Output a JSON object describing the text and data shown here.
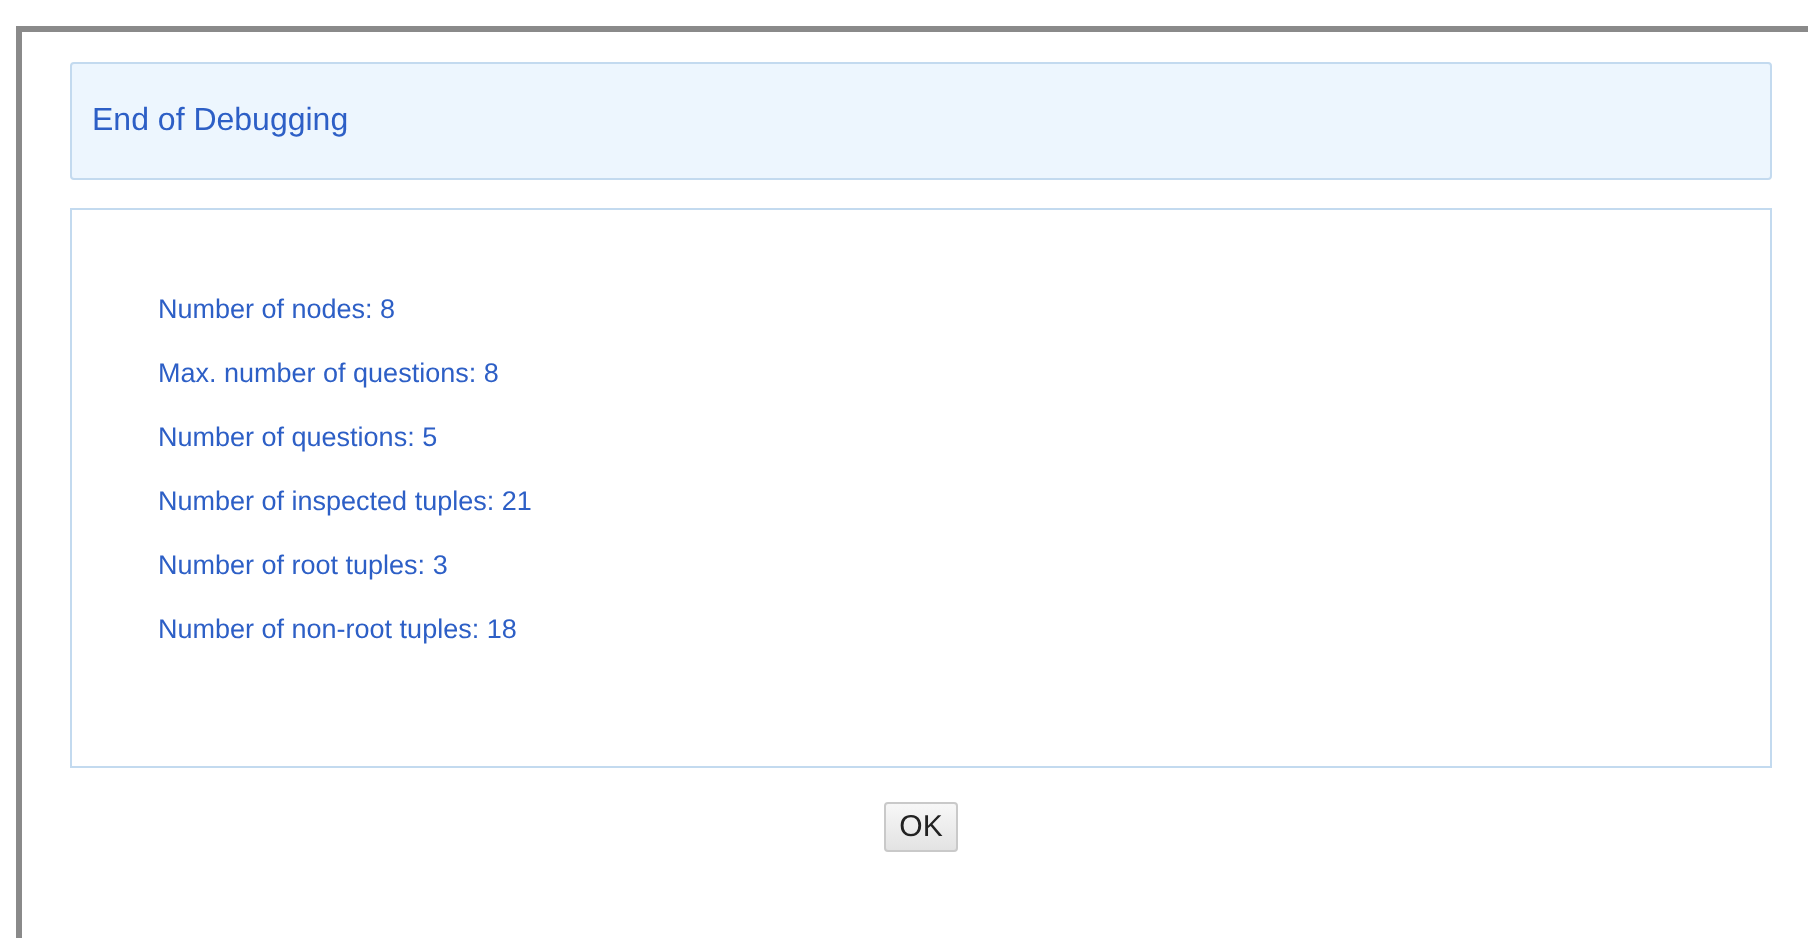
{
  "dialog": {
    "title": "End of Debugging",
    "stats": [
      "Number of nodes: 8",
      "Max. number of questions: 8",
      "Number of questions: 5",
      "Number of inspected tuples: 21",
      "Number of root tuples: 3",
      "Number of non-root tuples: 18"
    ],
    "buttons": [
      "OK"
    ]
  }
}
